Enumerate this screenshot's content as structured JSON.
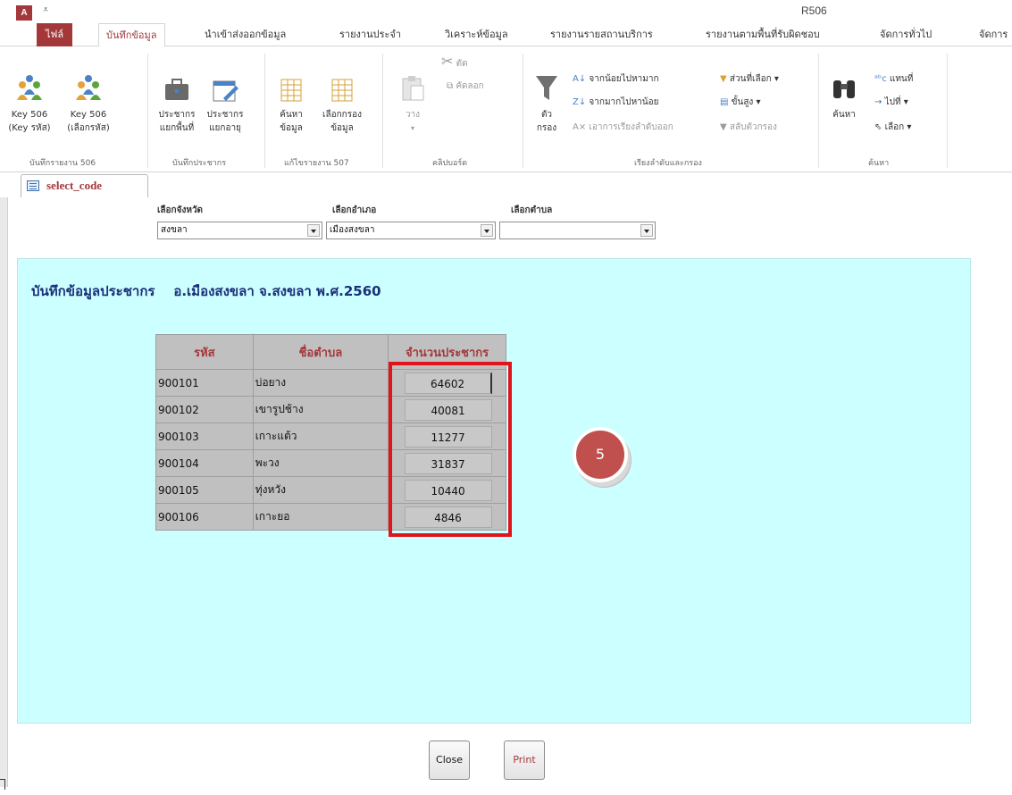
{
  "window": {
    "title": "R506",
    "app_icon": "A"
  },
  "tabs": [
    {
      "label": "ไฟล์"
    },
    {
      "label": "บันทึกข้อมูล"
    },
    {
      "label": "นำเข้าส่งออกข้อมูล"
    },
    {
      "label": "รายงานประจำ"
    },
    {
      "label": "วิเคราะห์ข้อมูล"
    },
    {
      "label": "รายงานรายสถานบริการ"
    },
    {
      "label": "รายงานตามพื้นที่รับผิดชอบ"
    },
    {
      "label": "จัดการทั่วไป"
    },
    {
      "label": "จัดการ"
    }
  ],
  "ribbon": {
    "key506_code": "Key 506\n(Key รหัส)",
    "key506_select": "Key 506\n(เลือกรหัส)",
    "group_506": "บันทึกรายงาน 506",
    "pop_area": "ประชากร\nแยกพื้นที่",
    "pop_age": "ประชากร\nแยกอายุ",
    "group_pop": "บันทึกประชากร",
    "search_data": "ค้นหา\nข้อมูล",
    "filter_data": "เลือกกรอง\nข้อมูล",
    "group_507": "แก้ไขรายงาน 507",
    "paste": "วาง",
    "cut": "ตัด",
    "copy": "คัดลอก",
    "group_clipboard": "คลิปบอร์ด",
    "filter": "ตัว\nกรอง",
    "sort_asc": "จากน้อยไปหามาก",
    "sort_desc": "จากมากไปหาน้อย",
    "remove_sort": "เอาการเรียงลำดับออก",
    "selection": "ส่วนที่เลือก ▾",
    "advanced": "ขั้นสูง ▾",
    "toggle_filter": "สลับตัวกรอง",
    "group_sort": "เรียงลำดับและกรอง",
    "find": "ค้นหา",
    "replace": "แทนที่",
    "goto": "ไปที่ ▾",
    "select": "เลือก ▾",
    "group_find": "ค้นหา"
  },
  "document_tab": {
    "label": "select_code"
  },
  "filters": {
    "province": {
      "label": "เลือกจังหวัด",
      "value": "สงขลา"
    },
    "district": {
      "label": "เลือกอำเภอ",
      "value": "เมืองสงขลา"
    },
    "subdistrict": {
      "label": "เลือกตำบล",
      "value": ""
    }
  },
  "report": {
    "heading": "บันทึกข้อมูลประชากร    อ.เมืองสงขลา จ.สงขลา พ.ศ.2560",
    "columns": [
      "รหัส",
      "ชื่อตำบล",
      "จำนวนประชากร"
    ],
    "rows": [
      [
        "900101",
        "บ่อยาง",
        "64602"
      ],
      [
        "900102",
        "เขารูปช้าง",
        "40081"
      ],
      [
        "900103",
        "เกาะแต้ว",
        "11277"
      ],
      [
        "900104",
        "พะวง",
        "31837"
      ],
      [
        "900105",
        "ทุ่งหวัง",
        "10440"
      ],
      [
        "900106",
        "เกาะยอ",
        "4846"
      ]
    ]
  },
  "step_marker": "5",
  "buttons": {
    "close": "Close",
    "print": "Print"
  },
  "colors": {
    "accent": "#a4373a",
    "detail_bg": "#ccffff",
    "highlight": "#e0141a",
    "marker": "#c0504d"
  }
}
